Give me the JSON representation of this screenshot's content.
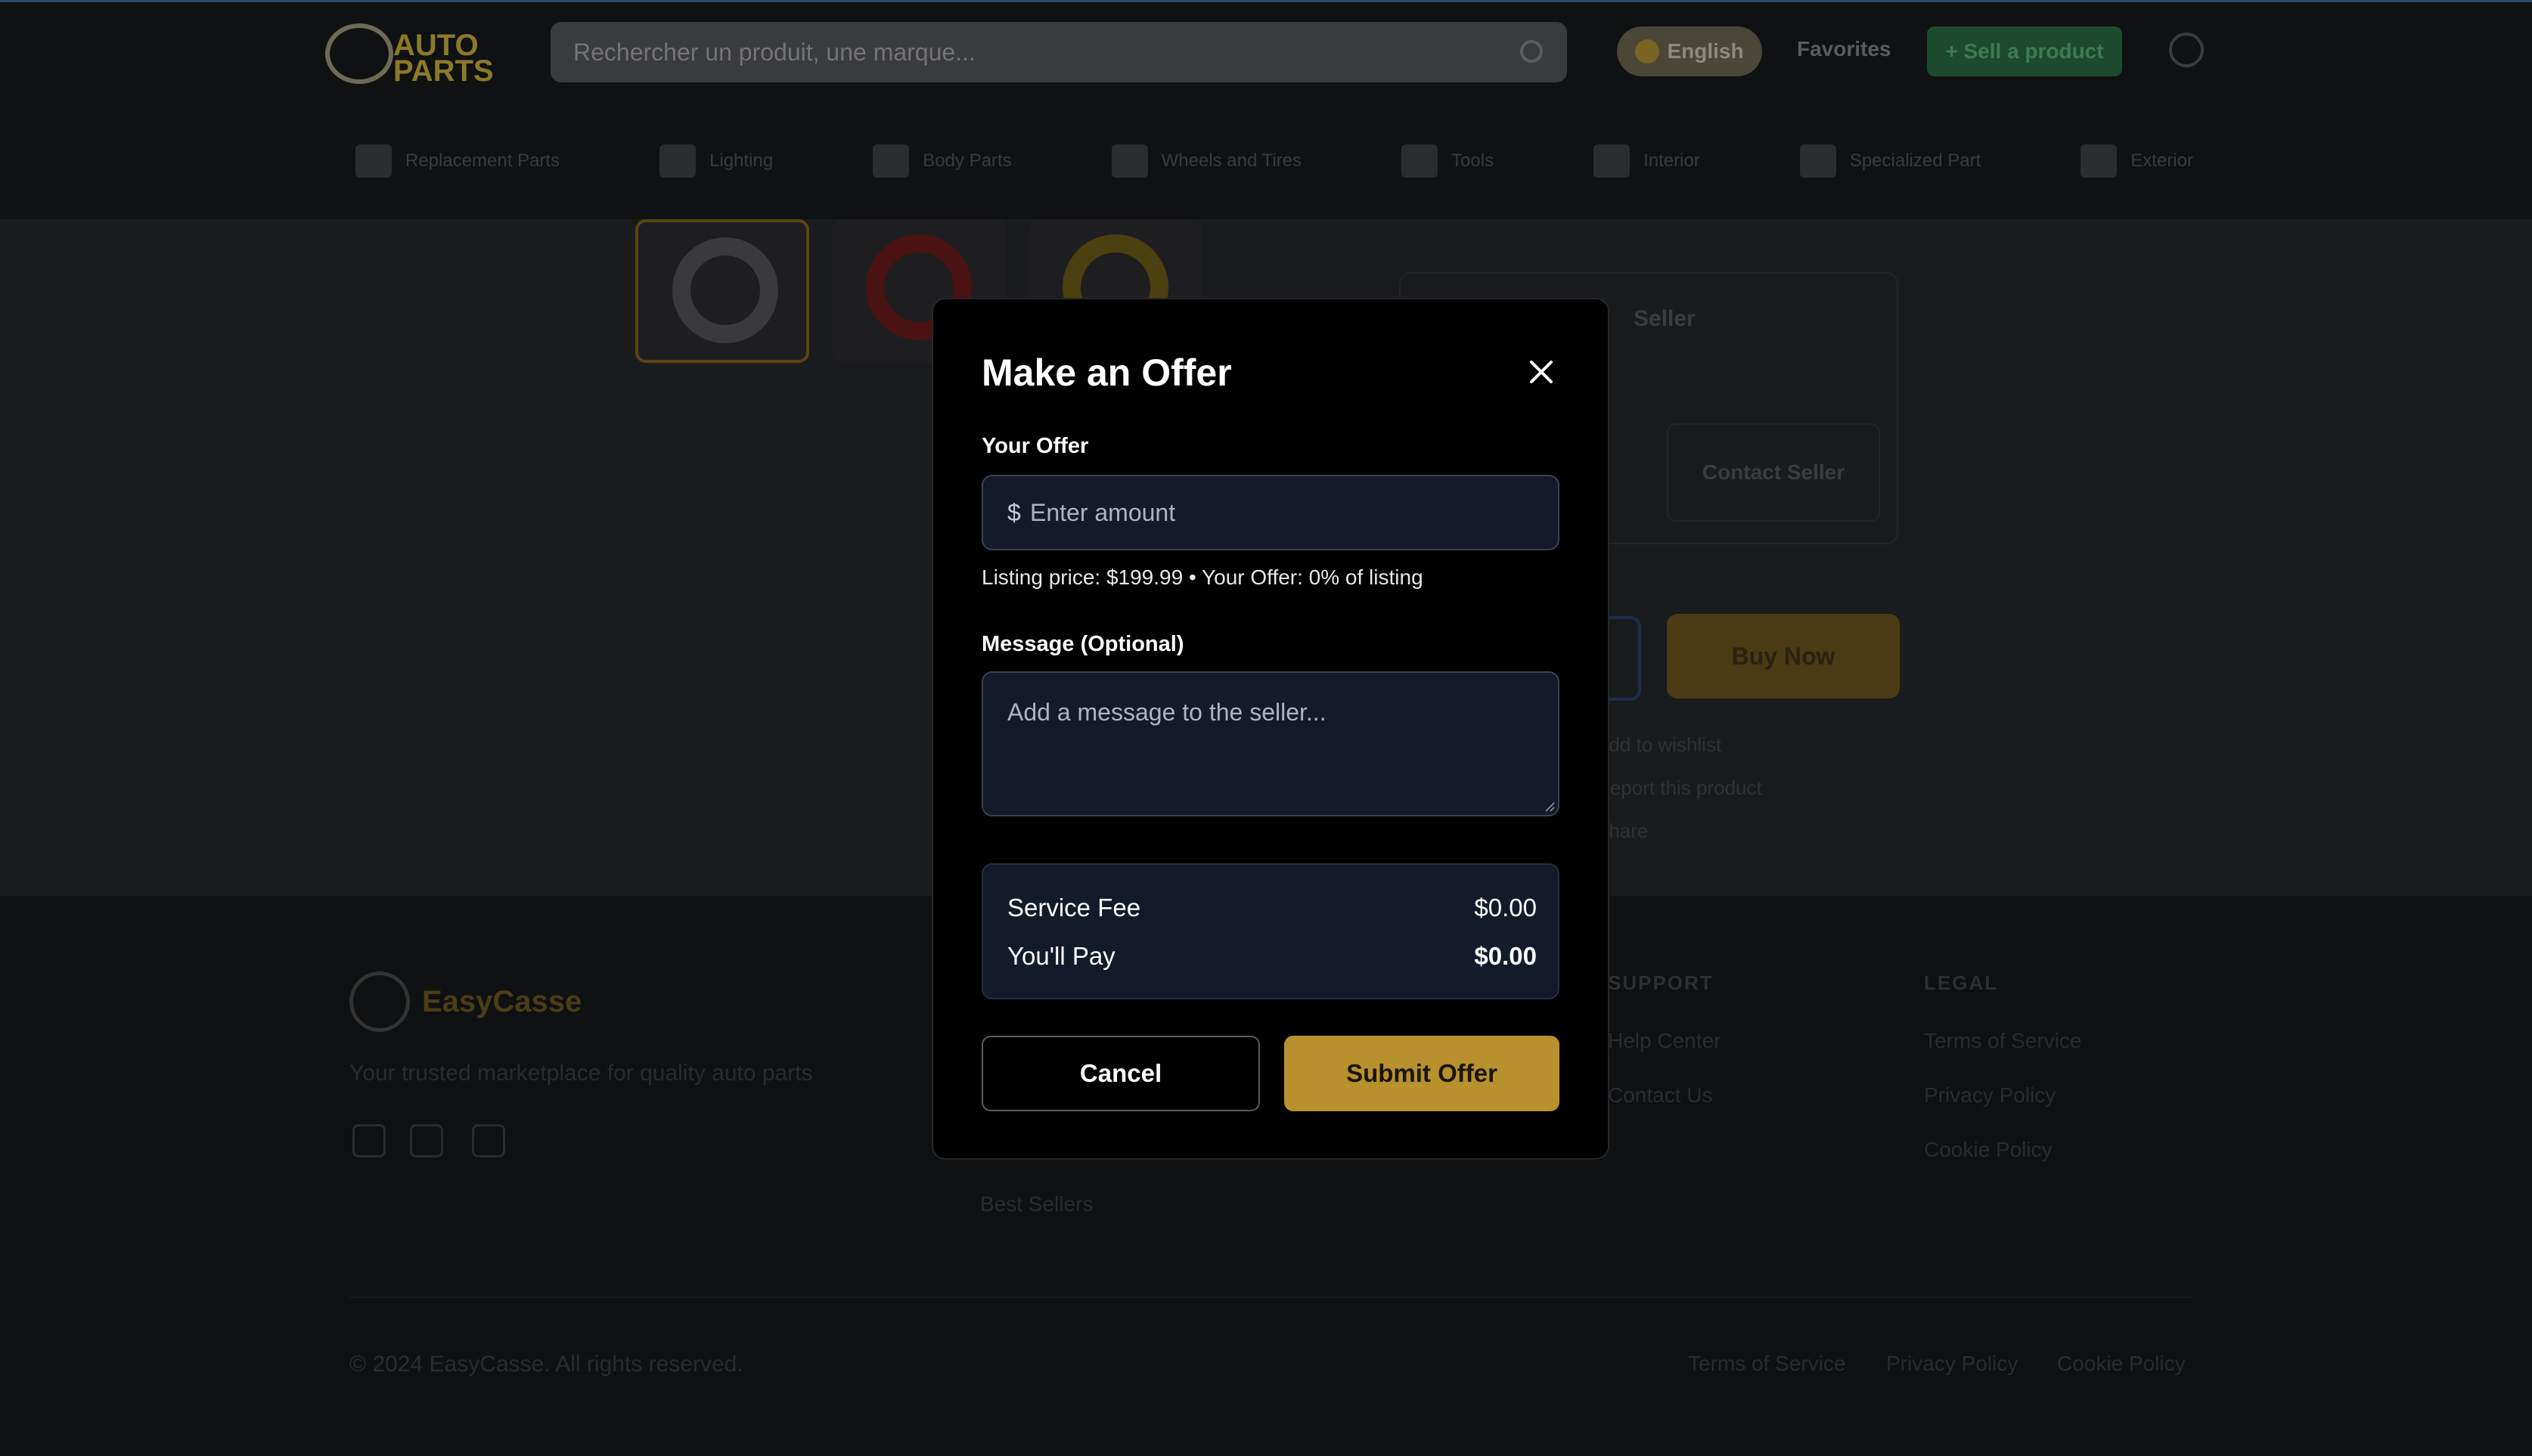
{
  "header": {
    "logo_text": "AUTO PARTS",
    "search_placeholder": "Rechercher un produit, une marque...",
    "language": "English",
    "favorites": "Favorites",
    "sell_button": "+ Sell a product"
  },
  "nav": {
    "items": [
      {
        "label": "Replacement Parts"
      },
      {
        "label": "Lighting"
      },
      {
        "label": "Body Parts"
      },
      {
        "label": "Wheels and Tires"
      },
      {
        "label": "Tools"
      },
      {
        "label": "Interior"
      },
      {
        "label": "Specialized Part"
      },
      {
        "label": "Exterior"
      }
    ]
  },
  "product": {
    "seller_label": "Seller",
    "contact_seller": "Contact Seller",
    "buy_now": "Buy Now",
    "lines": [
      "Add to wishlist",
      "Report this product",
      "Share"
    ]
  },
  "footer": {
    "brand": "EasyCasse",
    "tagline": "Your trusted marketplace for quality auto parts",
    "col_support_title": "SUPPORT",
    "col_legal_title": "LEGAL",
    "support_links": [
      "Help Center",
      "Contact Us"
    ],
    "legal_links": [
      "Terms of Service",
      "Privacy Policy",
      "Cookie Policy"
    ],
    "other_links": [
      "Best Sellers"
    ],
    "copyright": "© 2024 EasyCasse. All rights reserved.",
    "bottom_links": [
      "Terms of Service",
      "Privacy Policy",
      "Cookie Policy"
    ]
  },
  "modal": {
    "title": "Make an Offer",
    "offer_label": "Your Offer",
    "currency_symbol": "$",
    "amount_placeholder": "Enter amount",
    "listing_hint": "Listing price: $199.99 • Your Offer: 0% of listing",
    "message_label": "Message (Optional)",
    "message_placeholder": "Add a message to the seller...",
    "fees": {
      "service_fee_label": "Service Fee",
      "service_fee_value": "$0.00",
      "total_label": "You'll Pay",
      "total_value": "$0.00"
    },
    "cancel": "Cancel",
    "submit": "Submit Offer"
  },
  "colors": {
    "accent": "#b8902d",
    "input_bg": "#131a29",
    "modal_bg": "#000000"
  }
}
